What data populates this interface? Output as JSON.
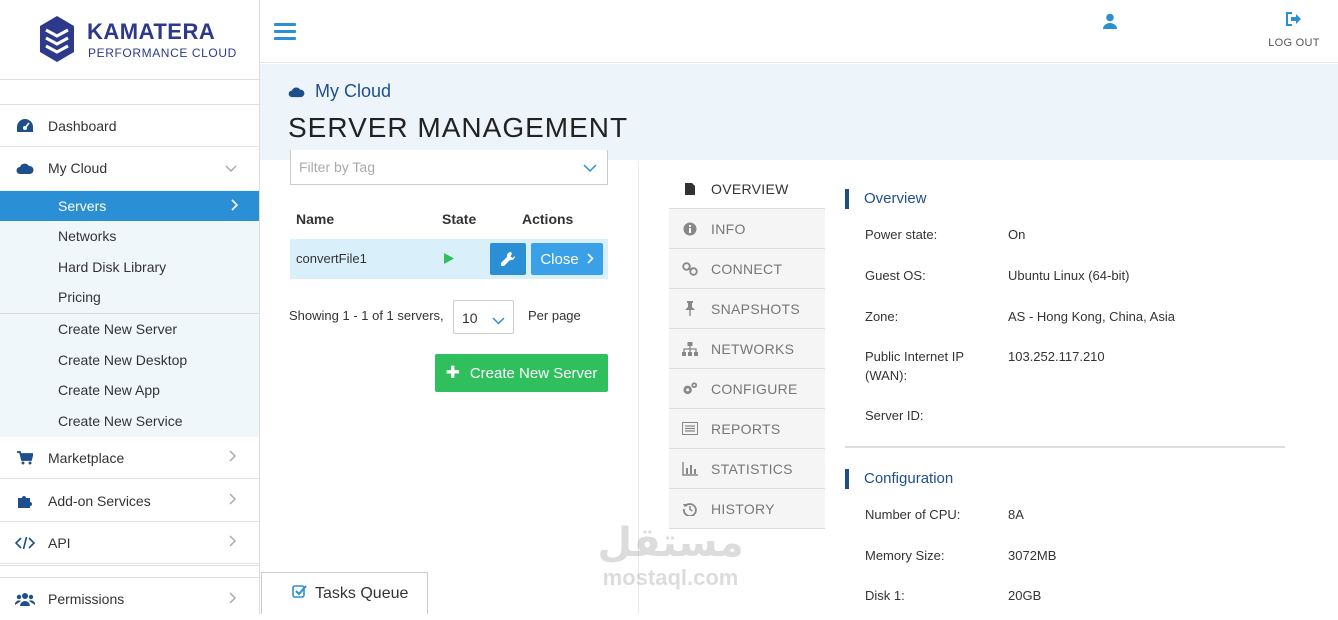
{
  "brand": {
    "name": "KAMATERA",
    "tagline": "PERFORMANCE CLOUD"
  },
  "topbar": {
    "logout_label": "LOG OUT",
    "icons": {
      "menu": "hamburger-icon",
      "user": "user-icon",
      "logout": "sign-out-icon"
    }
  },
  "sidebar": {
    "items": [
      {
        "label": "Dashboard",
        "icon": "dashboard-icon"
      },
      {
        "label": "My Cloud",
        "icon": "cloud-icon"
      },
      {
        "label": "Marketplace",
        "icon": "cart-icon"
      },
      {
        "label": "Add-on Services",
        "icon": "puzzle-icon"
      },
      {
        "label": "API",
        "icon": "code-icon"
      },
      {
        "label": "Permissions",
        "icon": "users-icon"
      }
    ],
    "mycloud_sub": [
      "Servers",
      "Networks",
      "Hard Disk Library",
      "Pricing"
    ],
    "create_sub": [
      "Create New Server",
      "Create New Desktop",
      "Create New App",
      "Create New Service"
    ]
  },
  "header": {
    "breadcrumb": "My Cloud",
    "title": "SERVER MANAGEMENT"
  },
  "servers": {
    "filter_placeholder": "Filter by Tag",
    "columns": [
      "Name",
      "State",
      "Actions"
    ],
    "rows": [
      {
        "name": "convertFile1",
        "state": "running",
        "action_close": "Close"
      }
    ],
    "showing": "Showing 1 - 1 of 1 servers,",
    "per_page_value": "10",
    "per_page_label": "Per page",
    "create_button": "Create New Server",
    "tasks_queue": "Tasks Queue"
  },
  "tabs": [
    {
      "label": "OVERVIEW",
      "icon": "file-icon",
      "active": true
    },
    {
      "label": "INFO",
      "icon": "info-icon"
    },
    {
      "label": "CONNECT",
      "icon": "link-icon"
    },
    {
      "label": "SNAPSHOTS",
      "icon": "pin-icon"
    },
    {
      "label": "NETWORKS",
      "icon": "sitemap-icon"
    },
    {
      "label": "CONFIGURE",
      "icon": "cogs-icon"
    },
    {
      "label": "REPORTS",
      "icon": "list-icon"
    },
    {
      "label": "STATISTICS",
      "icon": "bar-chart-icon"
    },
    {
      "label": "HISTORY",
      "icon": "history-icon"
    }
  ],
  "overview": {
    "title": "Overview",
    "fields": [
      {
        "label": "Power state:",
        "value": "On"
      },
      {
        "label": "Guest OS:",
        "value": "Ubuntu Linux (64-bit)"
      },
      {
        "label": "Zone:",
        "value": "AS - Hong Kong, China, Asia"
      },
      {
        "label": "Public Internet IP (WAN):",
        "value": "103.252.117.210"
      },
      {
        "label": "Server ID:",
        "value": ""
      }
    ]
  },
  "configuration": {
    "title": "Configuration",
    "fields": [
      {
        "label": "Number of CPU:",
        "value": "8A"
      },
      {
        "label": "Memory Size:",
        "value": "3072MB"
      },
      {
        "label": "Disk 1:",
        "value": "20GB"
      }
    ]
  },
  "watermark": {
    "arabic": "مستقل",
    "latin": "mostaql.com"
  },
  "colors": {
    "primary": "#2b8fd6",
    "brand": "#2d3a8c",
    "success": "#2fbf5c",
    "header_bg": "#eef5fa"
  }
}
